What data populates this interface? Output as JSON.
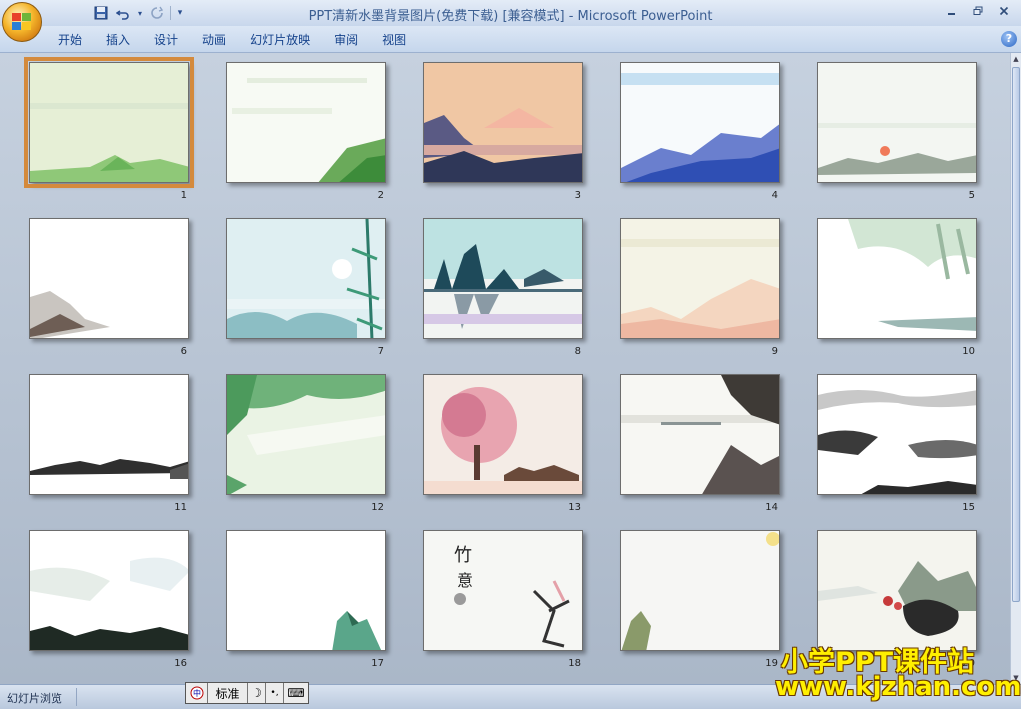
{
  "window": {
    "title": "PPT清新水墨背景图片(免费下载) [兼容模式] - Microsoft PowerPoint",
    "controls": [
      "minimize",
      "restore",
      "close"
    ]
  },
  "quick_access": {
    "save_icon": "save-icon",
    "undo_icon": "undo-icon",
    "redo_icon": "redo-icon",
    "customize_icon": "customize-qat-icon"
  },
  "ribbon": {
    "tabs": [
      "开始",
      "插入",
      "设计",
      "动画",
      "幻灯片放映",
      "审阅",
      "视图"
    ],
    "help_label": "?"
  },
  "slides": [
    {
      "number": "1",
      "selected": true
    },
    {
      "number": "2"
    },
    {
      "number": "3"
    },
    {
      "number": "4"
    },
    {
      "number": "5"
    },
    {
      "number": "6"
    },
    {
      "number": "7"
    },
    {
      "number": "8"
    },
    {
      "number": "9"
    },
    {
      "number": "10"
    },
    {
      "number": "11"
    },
    {
      "number": "12"
    },
    {
      "number": "13"
    },
    {
      "number": "14"
    },
    {
      "number": "15"
    },
    {
      "number": "16"
    },
    {
      "number": "17"
    },
    {
      "number": "18"
    },
    {
      "number": "19"
    },
    {
      "number": "20"
    }
  ],
  "statusbar": {
    "view_label": "幻灯片浏览"
  },
  "ime": {
    "mode_label": "标准",
    "moon": "☽",
    "punct": "•,",
    "keyboard": "⌨"
  },
  "watermark": {
    "line1": "小学PPT课件站",
    "line2": "www.kjzhan.com"
  },
  "colors": {
    "selection": "#d48a3c",
    "tab_text": "#15428b",
    "watermark": "#ffef00"
  }
}
